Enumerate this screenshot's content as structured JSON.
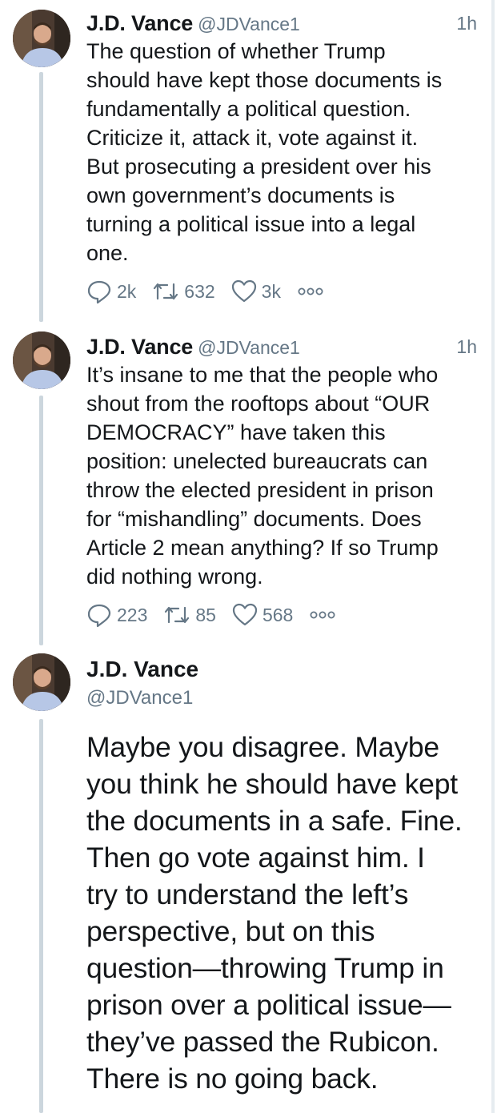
{
  "tweets": [
    {
      "name": "J.D. Vance",
      "handle": "@JDVance1",
      "time": "1h",
      "lines": [
        "The question of whether Trump",
        "should have kept those documents is",
        "fundamentally a political question.",
        "Criticize it, attack it, vote against it.",
        "But prosecuting a president over his",
        "own government’s documents is",
        "turning a political issue into a legal",
        "one."
      ],
      "replies": "2k",
      "retweets": "632",
      "likes": "3k"
    },
    {
      "name": "J.D. Vance",
      "handle": "@JDVance1",
      "time": "1h",
      "lines": [
        "It’s insane to me that the people who",
        "shout from the rooftops about “OUR",
        "DEMOCRACY” have taken this",
        "position: unelected bureaucrats can",
        "throw the elected president in prison",
        "for “mishandling” documents. Does",
        "Article 2 mean anything? If so Trump",
        "did nothing wrong."
      ],
      "replies": "223",
      "retweets": "85",
      "likes": "568"
    }
  ],
  "main_tweet": {
    "name": "J.D. Vance",
    "handle": "@JDVance1",
    "lines": [
      "Maybe you disagree. Maybe",
      "you think he should have kept",
      "the documents in a safe. Fine.",
      "Then go vote against him. I",
      "try to understand the left’s",
      "perspective, but on this",
      "question—throwing Trump in",
      "prison over a political issue—",
      "they’ve passed the Rubicon.",
      "There is no going back."
    ]
  },
  "icons": {
    "reply": "reply-icon",
    "retweet": "retweet-icon",
    "like": "heart-icon",
    "more": "more-icon"
  },
  "colors": {
    "text": "#14171a",
    "secondary": "#657786",
    "thread_line": "#ccd6dd"
  }
}
